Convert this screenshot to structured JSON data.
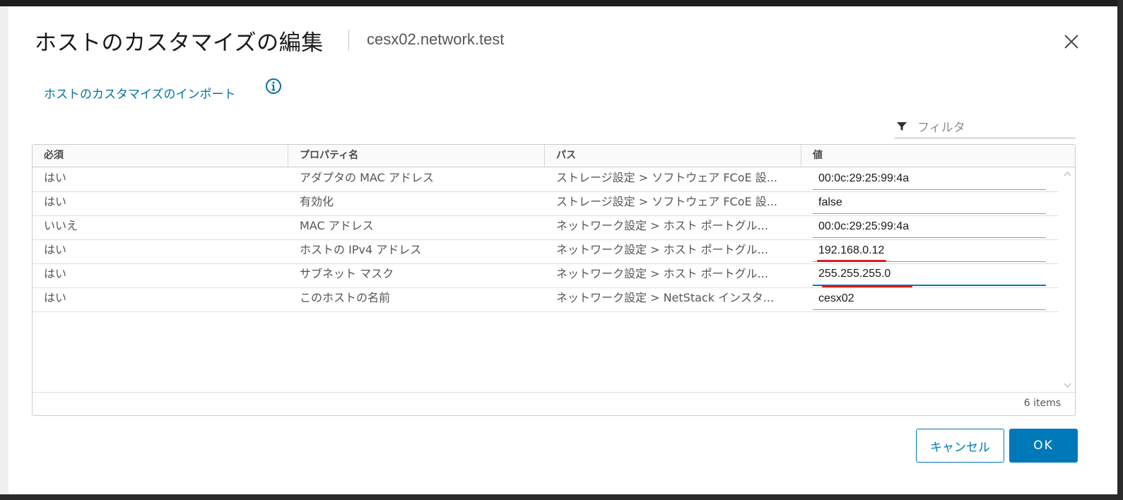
{
  "dialog": {
    "title": "ホストのカスタマイズの編集",
    "subtitle": "cesx02.network.test",
    "close_icon": "close-icon"
  },
  "import_link": {
    "label": "ホストのカスタマイズのインポート",
    "info_icon": "info-icon"
  },
  "filter": {
    "placeholder": "フィルタ",
    "value": "",
    "icon": "filter-icon"
  },
  "grid": {
    "columns": [
      "必須",
      "プロパティ名",
      "パス",
      "値"
    ],
    "rows": [
      {
        "required": "はい",
        "property": "アダプタの MAC アドレス",
        "path": "ストレージ設定 > ソフトウェア FCoE 設...",
        "value": "00:0c:29:25:99:4a"
      },
      {
        "required": "はい",
        "property": "有効化",
        "path": "ストレージ設定 > ソフトウェア FCoE 設...",
        "value": "false"
      },
      {
        "required": "いいえ",
        "property": "MAC アドレス",
        "path": "ネットワーク設定 > ホスト ポートグル...",
        "value": "00:0c:29:25:99:4a"
      },
      {
        "required": "はい",
        "property": "ホストの IPv4 アドレス",
        "path": "ネットワーク設定 > ホスト ポートグル...",
        "value": "192.168.0.12"
      },
      {
        "required": "はい",
        "property": "サブネット マスク",
        "path": "ネットワーク設定 > ホスト ポートグル...",
        "value": "255.255.255.0"
      },
      {
        "required": "はい",
        "property": "このホストの名前",
        "path": "ネットワーク設定 > NetStack インスタ...",
        "value": "cesx02"
      }
    ],
    "footer_count": "6 items"
  },
  "buttons": {
    "cancel": "キャンセル",
    "ok": "OK"
  },
  "colors": {
    "accent": "#0079b8",
    "link": "#0072a3",
    "annotation_red": "#d81d1d"
  }
}
